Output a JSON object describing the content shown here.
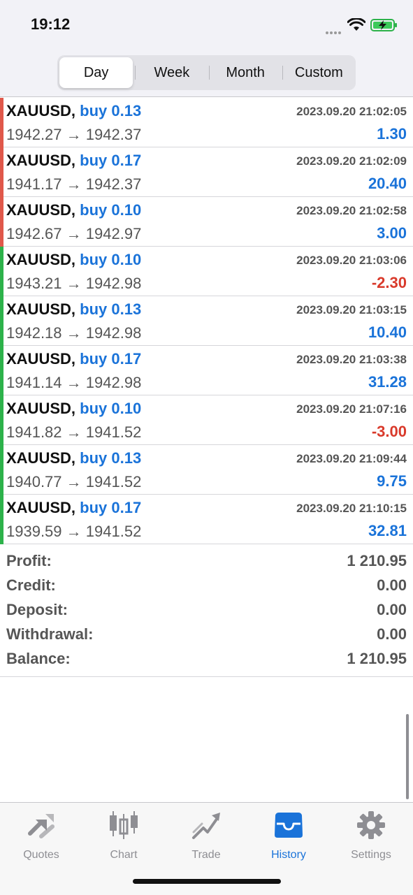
{
  "status_bar": {
    "time": "19:12"
  },
  "periods": [
    "Day",
    "Week",
    "Month",
    "Custom"
  ],
  "active_period": "Day",
  "deals": [
    {
      "symbol": "XAUUSD,",
      "direction": "buy 0.13",
      "time": "2023.09.20 21:02:05",
      "open": "1942.27",
      "arrow": "→",
      "close": "1942.37",
      "profit": "1.30",
      "profit_color": "#1a73d9",
      "side_color": "#e0584a"
    },
    {
      "symbol": "XAUUSD,",
      "direction": "buy 0.17",
      "time": "2023.09.20 21:02:09",
      "open": "1941.17",
      "arrow": "→",
      "close": "1942.37",
      "profit": "20.40",
      "profit_color": "#1a73d9",
      "side_color": "#e0584a"
    },
    {
      "symbol": "XAUUSD,",
      "direction": "buy 0.10",
      "time": "2023.09.20 21:02:58",
      "open": "1942.67",
      "arrow": "→",
      "close": "1942.97",
      "profit": "3.00",
      "profit_color": "#1a73d9",
      "side_color": "#e0584a"
    },
    {
      "symbol": "XAUUSD,",
      "direction": "buy 0.10",
      "time": "2023.09.20 21:03:06",
      "open": "1943.21",
      "arrow": "→",
      "close": "1942.98",
      "profit": "-2.30",
      "profit_color": "#d93a2b",
      "side_color": "#2db24a"
    },
    {
      "symbol": "XAUUSD,",
      "direction": "buy 0.13",
      "time": "2023.09.20 21:03:15",
      "open": "1942.18",
      "arrow": "→",
      "close": "1942.98",
      "profit": "10.40",
      "profit_color": "#1a73d9",
      "side_color": "#2db24a"
    },
    {
      "symbol": "XAUUSD,",
      "direction": "buy 0.17",
      "time": "2023.09.20 21:03:38",
      "open": "1941.14",
      "arrow": "→",
      "close": "1942.98",
      "profit": "31.28",
      "profit_color": "#1a73d9",
      "side_color": "#2db24a"
    },
    {
      "symbol": "XAUUSD,",
      "direction": "buy 0.10",
      "time": "2023.09.20 21:07:16",
      "open": "1941.82",
      "arrow": "→",
      "close": "1941.52",
      "profit": "-3.00",
      "profit_color": "#d93a2b",
      "side_color": "#2db24a"
    },
    {
      "symbol": "XAUUSD,",
      "direction": "buy 0.13",
      "time": "2023.09.20 21:09:44",
      "open": "1940.77",
      "arrow": "→",
      "close": "1941.52",
      "profit": "9.75",
      "profit_color": "#1a73d9",
      "side_color": "#2db24a"
    },
    {
      "symbol": "XAUUSD,",
      "direction": "buy 0.17",
      "time": "2023.09.20 21:10:15",
      "open": "1939.59",
      "arrow": "→",
      "close": "1941.52",
      "profit": "32.81",
      "profit_color": "#1a73d9",
      "side_color": "#2db24a"
    }
  ],
  "summary": [
    {
      "label": "Profit:",
      "value": "1 210.95"
    },
    {
      "label": "Credit:",
      "value": "0.00"
    },
    {
      "label": "Deposit:",
      "value": "0.00"
    },
    {
      "label": "Withdrawal:",
      "value": "0.00"
    },
    {
      "label": "Balance:",
      "value": "1 210.95"
    }
  ],
  "tabs": [
    {
      "label": "Quotes",
      "icon": "quotes-arrows-icon"
    },
    {
      "label": "Chart",
      "icon": "candlestick-chart-icon"
    },
    {
      "label": "Trade",
      "icon": "trade-trend-icon"
    },
    {
      "label": "History",
      "icon": "history-tray-icon"
    },
    {
      "label": "Settings",
      "icon": "settings-gear-icon"
    }
  ],
  "active_tab": "History",
  "colors": {
    "accent": "#1a73d9",
    "loss": "#d93a2b",
    "buy_side": "#e0584a",
    "sell_side": "#2db24a"
  }
}
